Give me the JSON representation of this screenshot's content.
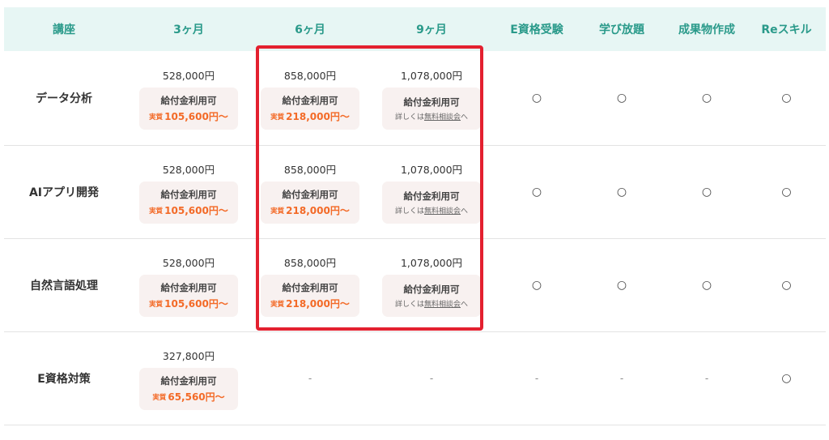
{
  "headers": [
    "講座",
    "3ヶ月",
    "6ヶ月",
    "9ヶ月",
    "E資格受験",
    "学び放題",
    "成果物作成",
    "Reスキル"
  ],
  "rows": [
    {
      "name": "データ分析",
      "p3": {
        "price": "528,000円",
        "title": "給付金利用可",
        "label": "実質",
        "real": "105,600円〜"
      },
      "p6": {
        "price": "858,000円",
        "title": "給付金利用可",
        "label": "実質",
        "real": "218,000円〜"
      },
      "p9": {
        "price": "1,078,000円",
        "title": "給付金利用可",
        "note_pre": "詳しくは",
        "note_link": "無料相談会",
        "note_post": "へ"
      },
      "marks": [
        "○",
        "○",
        "○",
        "○"
      ]
    },
    {
      "name": "AIアプリ開発",
      "p3": {
        "price": "528,000円",
        "title": "給付金利用可",
        "label": "実質",
        "real": "105,600円〜"
      },
      "p6": {
        "price": "858,000円",
        "title": "給付金利用可",
        "label": "実質",
        "real": "218,000円〜"
      },
      "p9": {
        "price": "1,078,000円",
        "title": "給付金利用可",
        "note_pre": "詳しくは",
        "note_link": "無料相談会",
        "note_post": "へ"
      },
      "marks": [
        "○",
        "○",
        "○",
        "○"
      ]
    },
    {
      "name": "自然言語処理",
      "p3": {
        "price": "528,000円",
        "title": "給付金利用可",
        "label": "実質",
        "real": "105,600円〜"
      },
      "p6": {
        "price": "858,000円",
        "title": "給付金利用可",
        "label": "実質",
        "real": "218,000円〜"
      },
      "p9": {
        "price": "1,078,000円",
        "title": "給付金利用可",
        "note_pre": "詳しくは",
        "note_link": "無料相談会",
        "note_post": "へ"
      },
      "marks": [
        "○",
        "○",
        "○",
        "○"
      ]
    },
    {
      "name": "E資格対策",
      "p3": {
        "price": "327,800円",
        "title": "給付金利用可",
        "label": "実質",
        "real": "65,560円〜"
      },
      "p6": "-",
      "p9": "-",
      "marks": [
        "-",
        "-",
        "-",
        "○"
      ]
    }
  ],
  "colors": {
    "header_bg": "#e7f6f4",
    "header_text": "#2a9a8a",
    "accent_orange": "#f36a27",
    "highlight_red": "#e3202f",
    "box_bg": "#f8f1f0"
  }
}
